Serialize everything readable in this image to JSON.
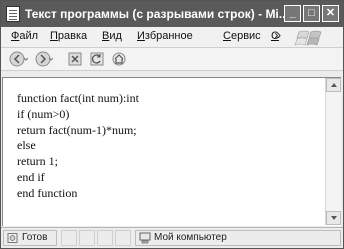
{
  "window": {
    "title": "Текст программы (с разрывами строк) - Mi..."
  },
  "menu": {
    "items": [
      {
        "first": "Ф",
        "rest": "айл"
      },
      {
        "first": "П",
        "rest": "равка"
      },
      {
        "first": "В",
        "rest": "ид"
      },
      {
        "first": "И",
        "rest": "збранное"
      },
      {
        "first": "С",
        "rest": "ервис"
      },
      {
        "first": "С",
        "rest": ""
      }
    ],
    "more": "»"
  },
  "content": {
    "lines": [
      "function fact(int num):int",
      "if (num>0)",
      "return fact(num-1)*num;",
      "else",
      "return 1;",
      "end if",
      "end function"
    ]
  },
  "status": {
    "left_text": "Готов",
    "right_text": "Мой компьютер"
  }
}
